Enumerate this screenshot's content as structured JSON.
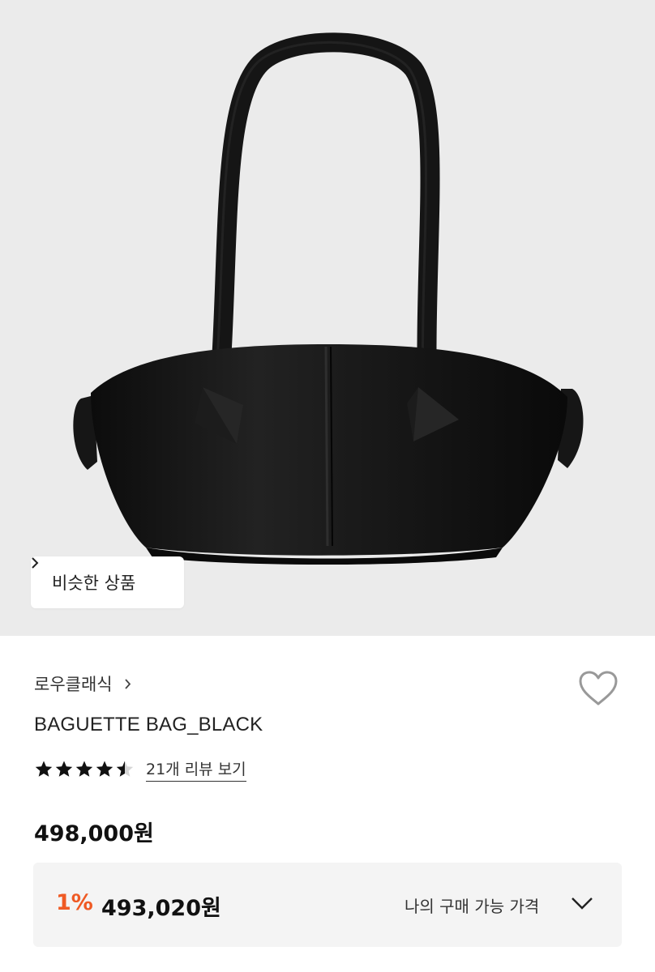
{
  "product_image": {
    "similar_button_label": "비슷한 상품",
    "chevron_icon": "chevron-right-icon",
    "background_color": "#ebebeb"
  },
  "product": {
    "brand": "로우클래식",
    "brand_chevron_icon": "chevron-right-icon",
    "wishlist_icon": "heart-outline-icon",
    "name": "BAGUETTE BAG_BLACK",
    "rating": 4.5,
    "rating_max": 5,
    "review_link": "21개 리뷰 보기",
    "price": "498,000원"
  },
  "benefit": {
    "rate": "1%",
    "price": "493,020원",
    "label": "나의 구매 가능 가격",
    "toggle_icon": "chevron-down-icon",
    "rate_color": "#ef5a24"
  }
}
